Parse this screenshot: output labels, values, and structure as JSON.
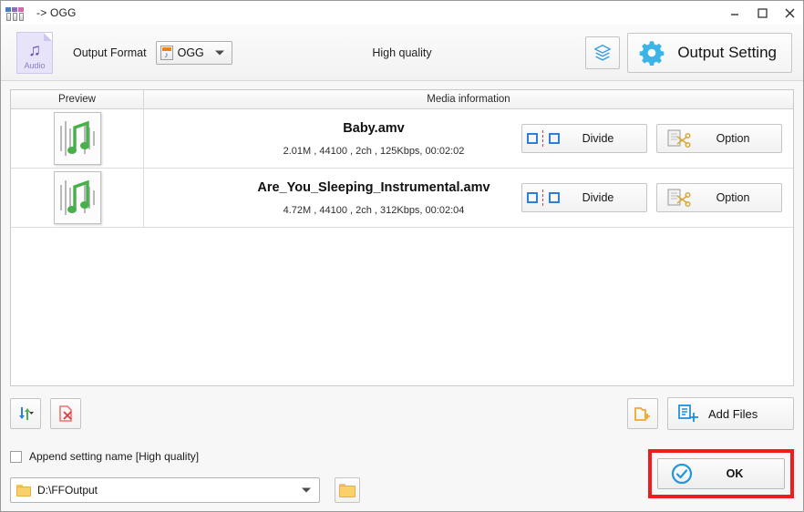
{
  "window": {
    "title": "-> OGG",
    "icon": "three-people-icon",
    "controls": {
      "minimize": "minimize-icon",
      "maximize": "maximize-icon",
      "close": "close-icon"
    }
  },
  "toolbar": {
    "media_type_badge": {
      "label": "Audio",
      "icon": "music-note-icon"
    },
    "output_format_label": "Output Format",
    "output_format_value": "OGG",
    "quality_text": "High quality",
    "layers_button_icon": "layers-stack-icon",
    "output_setting_label": "Output Setting",
    "output_setting_icon": "gear-icon",
    "accent_color": "#3bb4e8"
  },
  "list": {
    "columns": [
      "Preview",
      "Media information"
    ],
    "rows": [
      {
        "thumbnail_icon": "audio-waveform-file-icon",
        "name": "Baby.amv",
        "meta": "2.01M , 44100 , 2ch , 125Kbps, 00:02:02",
        "divide_label": "Divide",
        "option_label": "Option"
      },
      {
        "thumbnail_icon": "audio-waveform-file-icon",
        "name": "Are_You_Sleeping_Instrumental.amv",
        "meta": "4.72M , 44100 , 2ch , 312Kbps, 00:02:04",
        "divide_label": "Divide",
        "option_label": "Option"
      }
    ]
  },
  "bottom": {
    "sort_button_icon": "sort-arrows-icon",
    "remove_button_icon": "remove-file-icon",
    "add_folder_button_icon": "add-folder-icon",
    "add_files_label": "Add Files",
    "add_files_icon": "add-document-icon",
    "append_setting_label": "Append setting name [High quality]",
    "append_setting_checked": false,
    "output_path": "D:\\FFOutput",
    "browse_icon": "folder-icon",
    "ok_label": "OK",
    "ok_icon": "check-circle-icon",
    "highlight_color": "#ee1c1c"
  }
}
